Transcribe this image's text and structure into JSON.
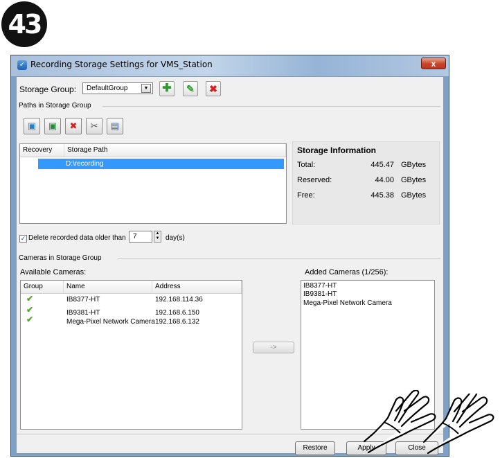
{
  "step_number": "43",
  "window": {
    "title": "Recording Storage Settings for VMS_Station",
    "close_glyph": "x"
  },
  "storage_group": {
    "label": "Storage Group:",
    "selected": "DefaultGroup",
    "add_icon": "plus-icon",
    "edit_icon": "pencil-icon",
    "delete_icon": "delete-x-icon"
  },
  "paths_section": {
    "title": "Paths in Storage Group",
    "toolbar_icons": [
      "add-path-icon",
      "add-path-alt-icon",
      "remove-path-icon",
      "tools-icon",
      "save-path-icon"
    ],
    "columns": [
      "Recovery",
      "Storage Path"
    ],
    "rows": [
      {
        "recovery": "",
        "path": "D:\\recording"
      }
    ]
  },
  "storage_info": {
    "title": "Storage Information",
    "rows": [
      {
        "label": "Total:",
        "value": "445.47",
        "unit": "GBytes"
      },
      {
        "label": "Reserved:",
        "value": "44.00",
        "unit": "GBytes"
      },
      {
        "label": "Free:",
        "value": "445.38",
        "unit": "GBytes"
      }
    ]
  },
  "retention": {
    "checked": true,
    "label": "Delete recorded data older than",
    "days": "7",
    "unit": "day(s)"
  },
  "cameras_section": {
    "title": "Cameras in Storage Group",
    "available_label": "Available Cameras:",
    "columns": [
      "Group",
      "Name",
      "Address"
    ],
    "available": [
      {
        "name": "IB8377-HT",
        "address": "192.168.114.36"
      },
      {
        "name": "IB9381-HT",
        "address": "192.168.6.150"
      },
      {
        "name": "Mega-Pixel Network Camera",
        "address": "192.168.6.132"
      }
    ],
    "move_button": "->",
    "added_label": "Added Cameras  (1/256):",
    "added": [
      "IB8377-HT",
      "IB9381-HT",
      "Mega-Pixel Network Camera"
    ]
  },
  "footer": {
    "restore": "Restore",
    "apply": "Apply",
    "close": "Close"
  },
  "colors": {
    "selection": "#3399ff",
    "check": "#58a02e",
    "title_bar": "#b3c8e2"
  }
}
